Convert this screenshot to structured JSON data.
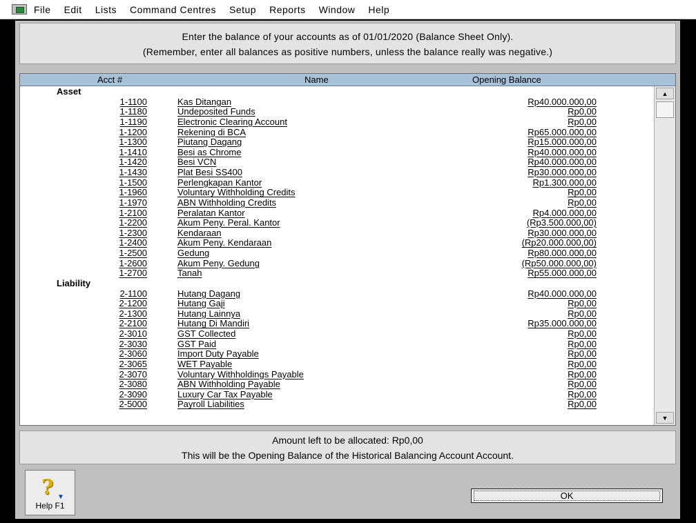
{
  "menubar": {
    "items": [
      "File",
      "Edit",
      "Lists",
      "Command Centres",
      "Setup",
      "Reports",
      "Window",
      "Help"
    ]
  },
  "instructions": {
    "line1": "Enter the balance of your accounts as of 01/01/2020 (Balance Sheet Only).",
    "line2": "(Remember, enter all balances as positive numbers, unless the balance really was negative.)"
  },
  "grid": {
    "headers": {
      "acct": "Acct #",
      "name": "Name",
      "balance": "Opening Balance"
    },
    "groups": [
      {
        "label": "Asset",
        "rows": [
          {
            "num": "1-1100",
            "name": "Kas Ditangan",
            "balance": "Rp40.000.000,00"
          },
          {
            "num": "1-1180",
            "name": "Undeposited Funds",
            "balance": "Rp0,00"
          },
          {
            "num": "1-1190",
            "name": "Electronic Clearing Account",
            "balance": "Rp0,00"
          },
          {
            "num": "1-1200",
            "name": "Rekening di BCA",
            "balance": "Rp65.000.000,00"
          },
          {
            "num": "1-1300",
            "name": "Piutang Dagang",
            "balance": "Rp15.000.000,00"
          },
          {
            "num": "1-1410",
            "name": "Besi as Chrome",
            "balance": "Rp40.000.000,00"
          },
          {
            "num": "1-1420",
            "name": "Besi VCN",
            "balance": "Rp40.000.000,00"
          },
          {
            "num": "1-1430",
            "name": "Plat Besi SS400",
            "balance": "Rp30.000.000,00"
          },
          {
            "num": "1-1500",
            "name": "Perlengkapan Kantor",
            "balance": "Rp1.300.000,00"
          },
          {
            "num": "1-1960",
            "name": "Voluntary Withholding Credits",
            "balance": "Rp0,00"
          },
          {
            "num": "1-1970",
            "name": "ABN Withholding Credits",
            "balance": "Rp0,00"
          },
          {
            "num": "1-2100",
            "name": "Peralatan Kantor",
            "balance": "Rp4.000.000,00"
          },
          {
            "num": "1-2200",
            "name": "Akum Peny. Peral. Kantor",
            "balance": "(Rp3.500.000,00)"
          },
          {
            "num": "1-2300",
            "name": "Kendaraan",
            "balance": "Rp30.000.000,00"
          },
          {
            "num": "1-2400",
            "name": "Akum Peny. Kendaraan",
            "balance": "(Rp20.000.000,00)"
          },
          {
            "num": "1-2500",
            "name": "Gedung",
            "balance": "Rp80.000.000,00"
          },
          {
            "num": "1-2600",
            "name": "Akum Peny. Gedung",
            "balance": "(Rp50.000.000,00)"
          },
          {
            "num": "1-2700",
            "name": "Tanah",
            "balance": "Rp55.000.000,00"
          }
        ]
      },
      {
        "label": "Liability",
        "rows": [
          {
            "num": "2-1100",
            "name": "Hutang Dagang",
            "balance": "Rp40.000.000,00"
          },
          {
            "num": "2-1200",
            "name": "Hutang Gaji",
            "balance": "Rp0,00"
          },
          {
            "num": "2-1300",
            "name": "Hutang Lainnya",
            "balance": "Rp0,00"
          },
          {
            "num": "2-2100",
            "name": "Hutang Di Mandiri",
            "balance": "Rp35.000.000,00"
          },
          {
            "num": "2-3010",
            "name": "GST Collected",
            "balance": "Rp0,00"
          },
          {
            "num": "2-3030",
            "name": "GST Paid",
            "balance": "Rp0,00"
          },
          {
            "num": "2-3060",
            "name": "Import Duty Payable",
            "balance": "Rp0,00"
          },
          {
            "num": "2-3065",
            "name": "WET Payable",
            "balance": "Rp0,00"
          },
          {
            "num": "2-3070",
            "name": "Voluntary Withholdings Payable",
            "balance": "Rp0,00"
          },
          {
            "num": "2-3080",
            "name": "ABN Withholding Payable",
            "balance": "Rp0,00"
          },
          {
            "num": "2-3090",
            "name": "Luxury Car Tax Payable",
            "balance": "Rp0,00"
          },
          {
            "num": "2-5000",
            "name": "Payroll Liabilities",
            "balance": "Rp0,00"
          }
        ]
      }
    ]
  },
  "footer": {
    "line1": "Amount left to be allocated:  Rp0,00",
    "line2": "This will be the Opening Balance of the Historical Balancing Account Account."
  },
  "buttons": {
    "help_label": "Help F1",
    "ok_label": "OK"
  },
  "icons": {
    "app": "app-window-icon",
    "help": "help-question-icon",
    "scroll_up": "scroll-up-icon",
    "scroll_down": "scroll-down-icon"
  }
}
